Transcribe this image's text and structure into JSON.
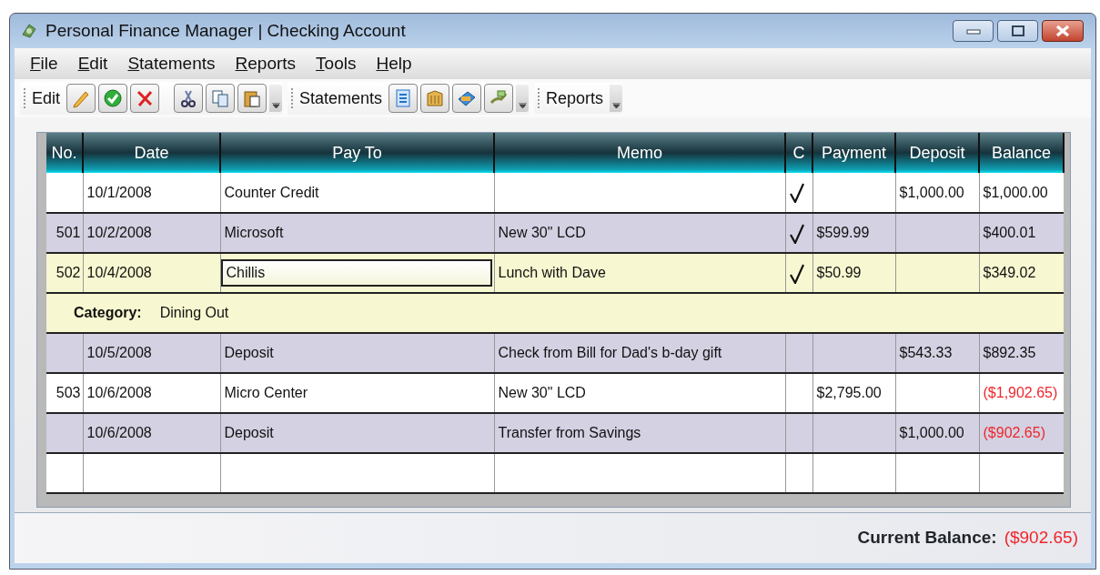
{
  "window": {
    "title": "Personal Finance Manager | Checking Account"
  },
  "menu": [
    "File",
    "Edit",
    "Statements",
    "Reports",
    "Tools",
    "Help"
  ],
  "toolbar": [
    {
      "label": "Edit"
    },
    {
      "label": "Statements"
    },
    {
      "label": "Reports"
    }
  ],
  "table": {
    "columns": [
      "No.",
      "Date",
      "Pay To",
      "Memo",
      "C",
      "Payment",
      "Deposit",
      "Balance"
    ],
    "rows": [
      {
        "kind": "transaction",
        "no": "",
        "date": "10/1/2008",
        "pay_to": "Counter Credit",
        "memo": "",
        "cleared": true,
        "payment": "",
        "deposit": "$1,000.00",
        "balance": "$1,000.00",
        "negative": false,
        "selected": false
      },
      {
        "kind": "transaction",
        "no": "501",
        "date": "10/2/2008",
        "pay_to": "Microsoft",
        "memo": "New 30\" LCD",
        "cleared": true,
        "payment": "$599.99",
        "deposit": "",
        "balance": "$400.01",
        "negative": false,
        "selected": false
      },
      {
        "kind": "transaction",
        "no": "502",
        "date": "10/4/2008",
        "pay_to": "Chillis",
        "memo": "Lunch with Dave",
        "cleared": true,
        "payment": "$50.99",
        "deposit": "",
        "balance": "$349.02",
        "negative": false,
        "selected": true,
        "detail": {
          "label": "Category:",
          "value": "Dining Out"
        }
      },
      {
        "kind": "transaction",
        "no": "",
        "date": "10/5/2008",
        "pay_to": "Deposit",
        "memo": "Check from Bill for Dad's b-day gift",
        "cleared": false,
        "payment": "",
        "deposit": "$543.33",
        "balance": "$892.35",
        "negative": false,
        "selected": false
      },
      {
        "kind": "transaction",
        "no": "503",
        "date": "10/6/2008",
        "pay_to": "Micro Center",
        "memo": "New 30\" LCD",
        "cleared": false,
        "payment": "$2,795.00",
        "deposit": "",
        "balance": "($1,902.65)",
        "negative": true,
        "selected": false
      },
      {
        "kind": "transaction",
        "no": "",
        "date": "10/6/2008",
        "pay_to": "Deposit",
        "memo": "Transfer from Savings",
        "cleared": false,
        "payment": "",
        "deposit": "$1,000.00",
        "balance": "($902.65)",
        "negative": true,
        "selected": false
      },
      {
        "kind": "blank",
        "selected": false
      }
    ]
  },
  "footer": {
    "label": "Current Balance:",
    "value": "($902.65)",
    "negative": true
  }
}
